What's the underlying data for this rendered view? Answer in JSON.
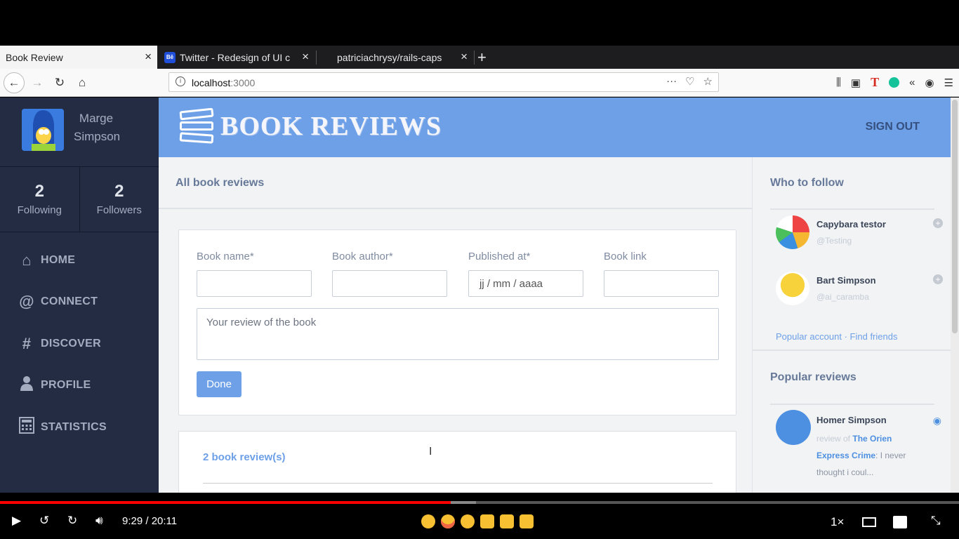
{
  "browser": {
    "tabs": [
      {
        "title": "Book Review",
        "active": true
      },
      {
        "title": "Twitter - Redesign of UI c",
        "favicon": "Bē",
        "active": false
      },
      {
        "title": "patriciachrysy/rails-caps",
        "active": false
      }
    ],
    "url_host": "localhost",
    "url_port": ":3000"
  },
  "sidebar": {
    "user_first": "Marge",
    "user_last": "Simpson",
    "following_count": "2",
    "following_label": "Following",
    "followers_count": "2",
    "followers_label": "Followers",
    "menu": [
      {
        "label": "HOME",
        "icon": "home-icon"
      },
      {
        "label": "CONNECT",
        "icon": "at-icon"
      },
      {
        "label": "DISCOVER",
        "icon": "hash-icon"
      },
      {
        "label": "PROFILE",
        "icon": "user-icon"
      },
      {
        "label": "STATISTICS",
        "icon": "calculator-icon"
      }
    ]
  },
  "header": {
    "logo": "BOOK REVIEWS",
    "signout": "SIGN OUT"
  },
  "main": {
    "title": "All book reviews",
    "form": {
      "book_name_label": "Book name*",
      "book_author_label": "Book author*",
      "published_label": "Published at*",
      "published_value": "jj / mm / aaaa",
      "link_label": "Book link",
      "review_placeholder": "Your review of the book",
      "done_label": "Done"
    },
    "reviews_count": "2 book review(s)"
  },
  "right": {
    "follow_title": "Who to follow",
    "follow": [
      {
        "name": "Capybara testor",
        "handle": "@Testing"
      },
      {
        "name": "Bart Simpson",
        "handle": "@ai_caramba"
      }
    ],
    "popular_account": "Popular account",
    "link_sep": "·",
    "find_friends": "Find friends",
    "popular_title": "Popular reviews",
    "review": {
      "name": "Homer Simpson",
      "prefix": "review of",
      "book": "The Orien Express Crime",
      "snippet": ": I never thought i coul..."
    }
  },
  "video": {
    "time": "9:29 / 20:11",
    "speed": "1×",
    "progress": 0.47
  },
  "colors": {
    "accent": "#6ea0e8",
    "sidebar": "#232c42",
    "progress": "#ff0000"
  }
}
